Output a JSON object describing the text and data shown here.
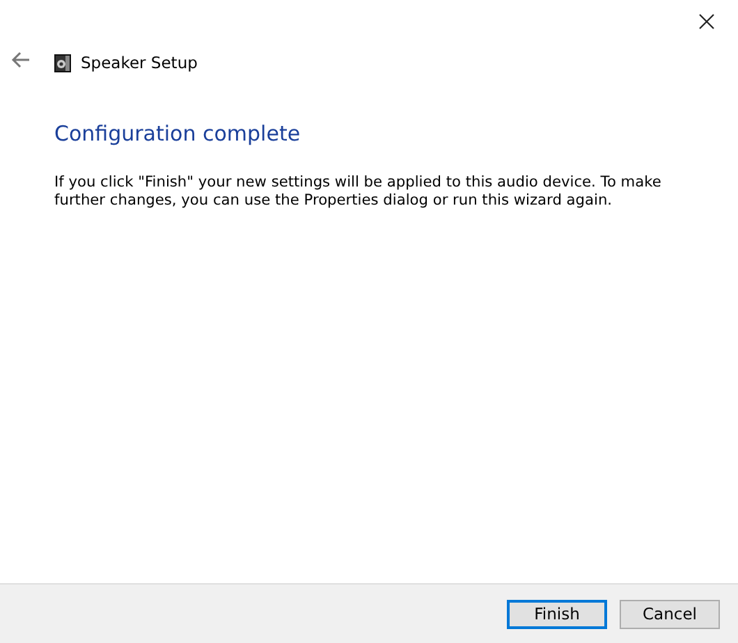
{
  "window": {
    "title": "Speaker Setup"
  },
  "heading": "Configuration complete",
  "message": "If you click \"Finish\" your new settings will be applied to this audio device.  To make further changes, you can use the Properties dialog or run this wizard again.",
  "buttons": [
    {
      "label": "Finish",
      "default": true
    },
    {
      "label": "Cancel",
      "default": false
    }
  ]
}
